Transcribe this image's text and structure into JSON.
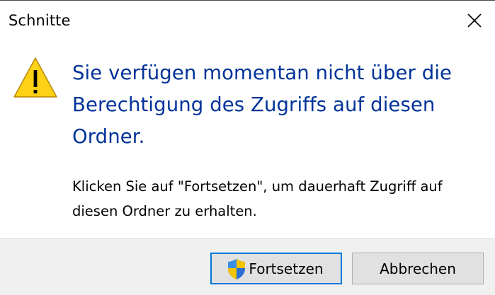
{
  "window": {
    "title": "Schnitte"
  },
  "message": {
    "heading": "Sie verfügen momentan nicht über die Berechtigung des Zugriffs auf diesen Ordner.",
    "body": "Klicken Sie auf \"Fortsetzen\", um dauerhaft Zugriff auf diesen Ordner zu erhalten."
  },
  "buttons": {
    "continue_label": "Fortsetzen",
    "cancel_label": "Abbrechen"
  },
  "icons": {
    "warning": "warning-icon",
    "shield": "uac-shield-icon",
    "close": "close-icon"
  },
  "colors": {
    "heading": "#003399",
    "default_button_border": "#0078d7",
    "warning_fill": "#fcd116"
  }
}
